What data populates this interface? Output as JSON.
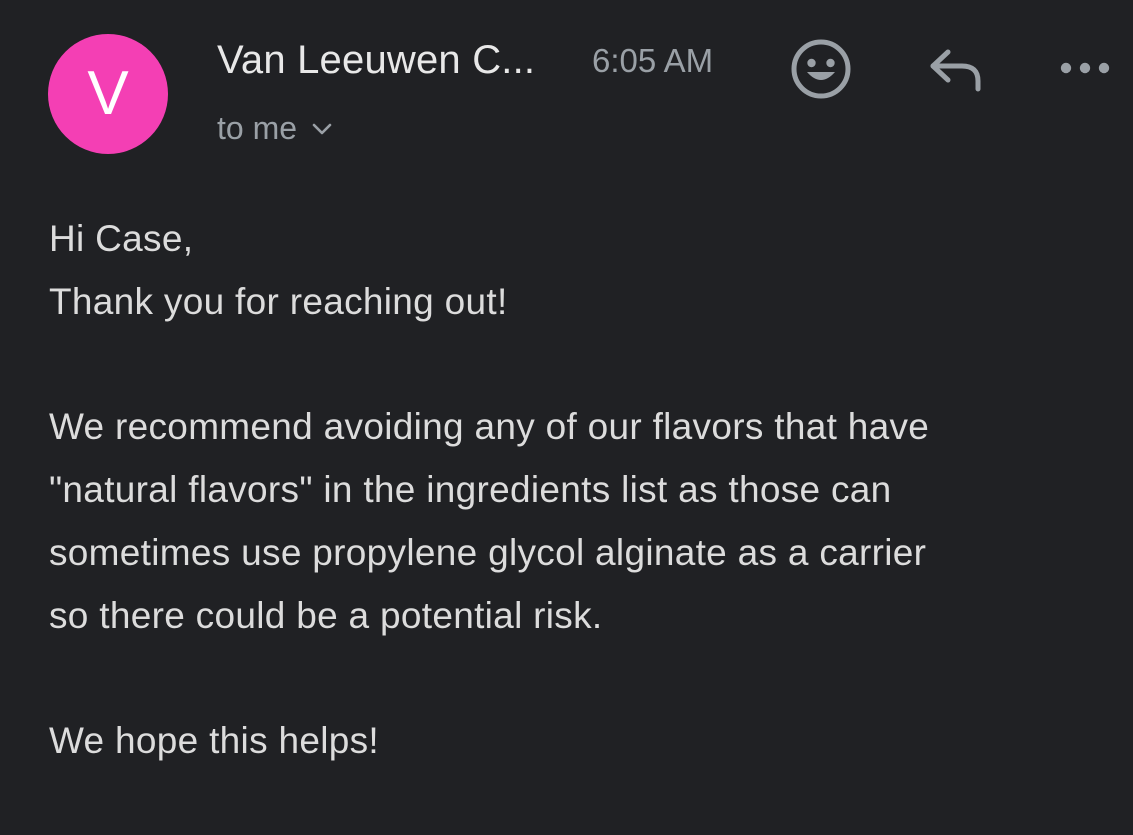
{
  "colors": {
    "background": "#202124",
    "avatar": "#f43fb4",
    "primary_text": "#e8e8e8",
    "secondary_text": "#9aa0a6"
  },
  "header": {
    "avatar_letter": "V",
    "sender": "Van Leeuwen C...",
    "time": "6:05 AM",
    "recipient": "to me",
    "icons": {
      "emoji": "smiley-face-icon",
      "reply": "reply-arrow-icon",
      "more": "more-dots-icon",
      "expand": "chevron-down-icon"
    }
  },
  "message": {
    "greeting": "Hi Case,",
    "thanks": "Thank you for reaching out!",
    "paragraph_lines": [
      "We recommend avoiding any of our flavors that have",
      "\"natural flavors\" in the ingredients list as those can",
      "sometimes use propylene glycol alginate as a carrier",
      "so there could be a potential risk."
    ],
    "closing": "We hope this helps!"
  }
}
